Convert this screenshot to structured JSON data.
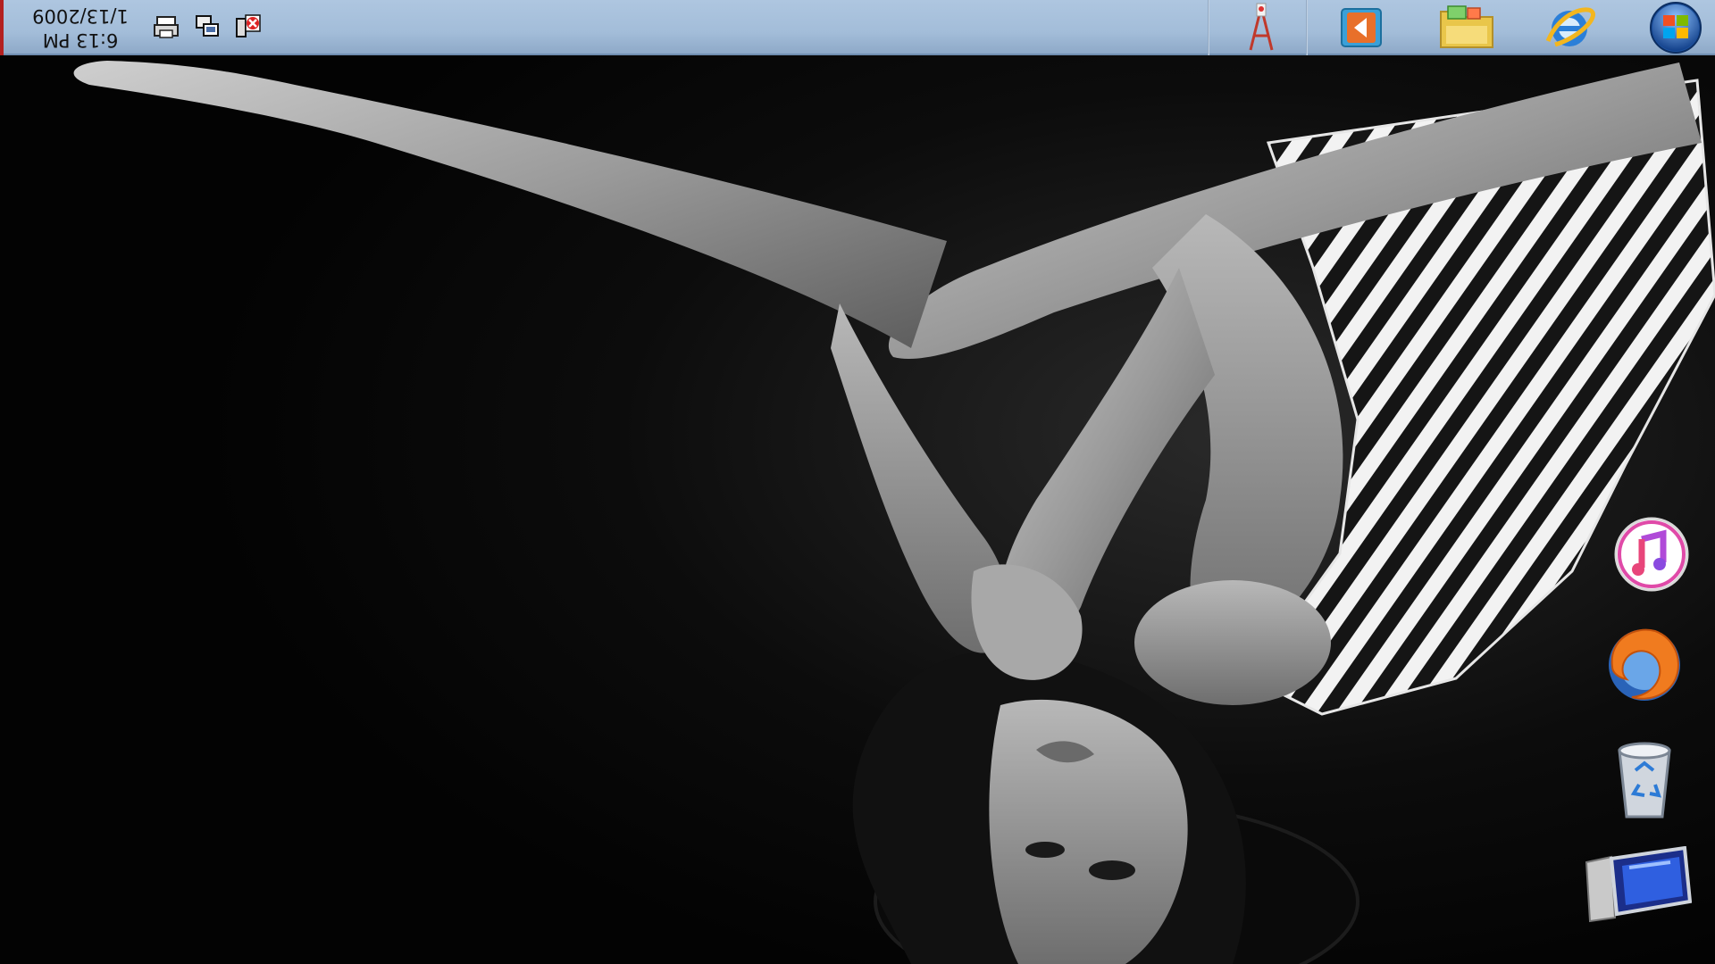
{
  "taskbar": {
    "clock": {
      "time": "6:13 PM",
      "date": "1/13/2009"
    },
    "tray_icons": [
      {
        "icon": "printer-icon"
      },
      {
        "icon": "network-icon"
      },
      {
        "icon": "network-error-icon"
      }
    ],
    "quick_launch": [
      {
        "icon": "network-tower-icon"
      },
      {
        "icon": "media-player-icon"
      },
      {
        "icon": "folder-icon"
      },
      {
        "icon": "internet-explorer-icon"
      },
      {
        "icon": "windows-start-orb-icon"
      }
    ]
  },
  "desktop_icons": [
    {
      "icon": "music-app-icon"
    },
    {
      "icon": "firefox-icon"
    },
    {
      "icon": "recycle-bin-icon"
    },
    {
      "icon": "computer-display-icon"
    }
  ],
  "colors": {
    "taskbar": "#a9c2dd",
    "accent_red": "#b32020",
    "background": "#050505"
  }
}
